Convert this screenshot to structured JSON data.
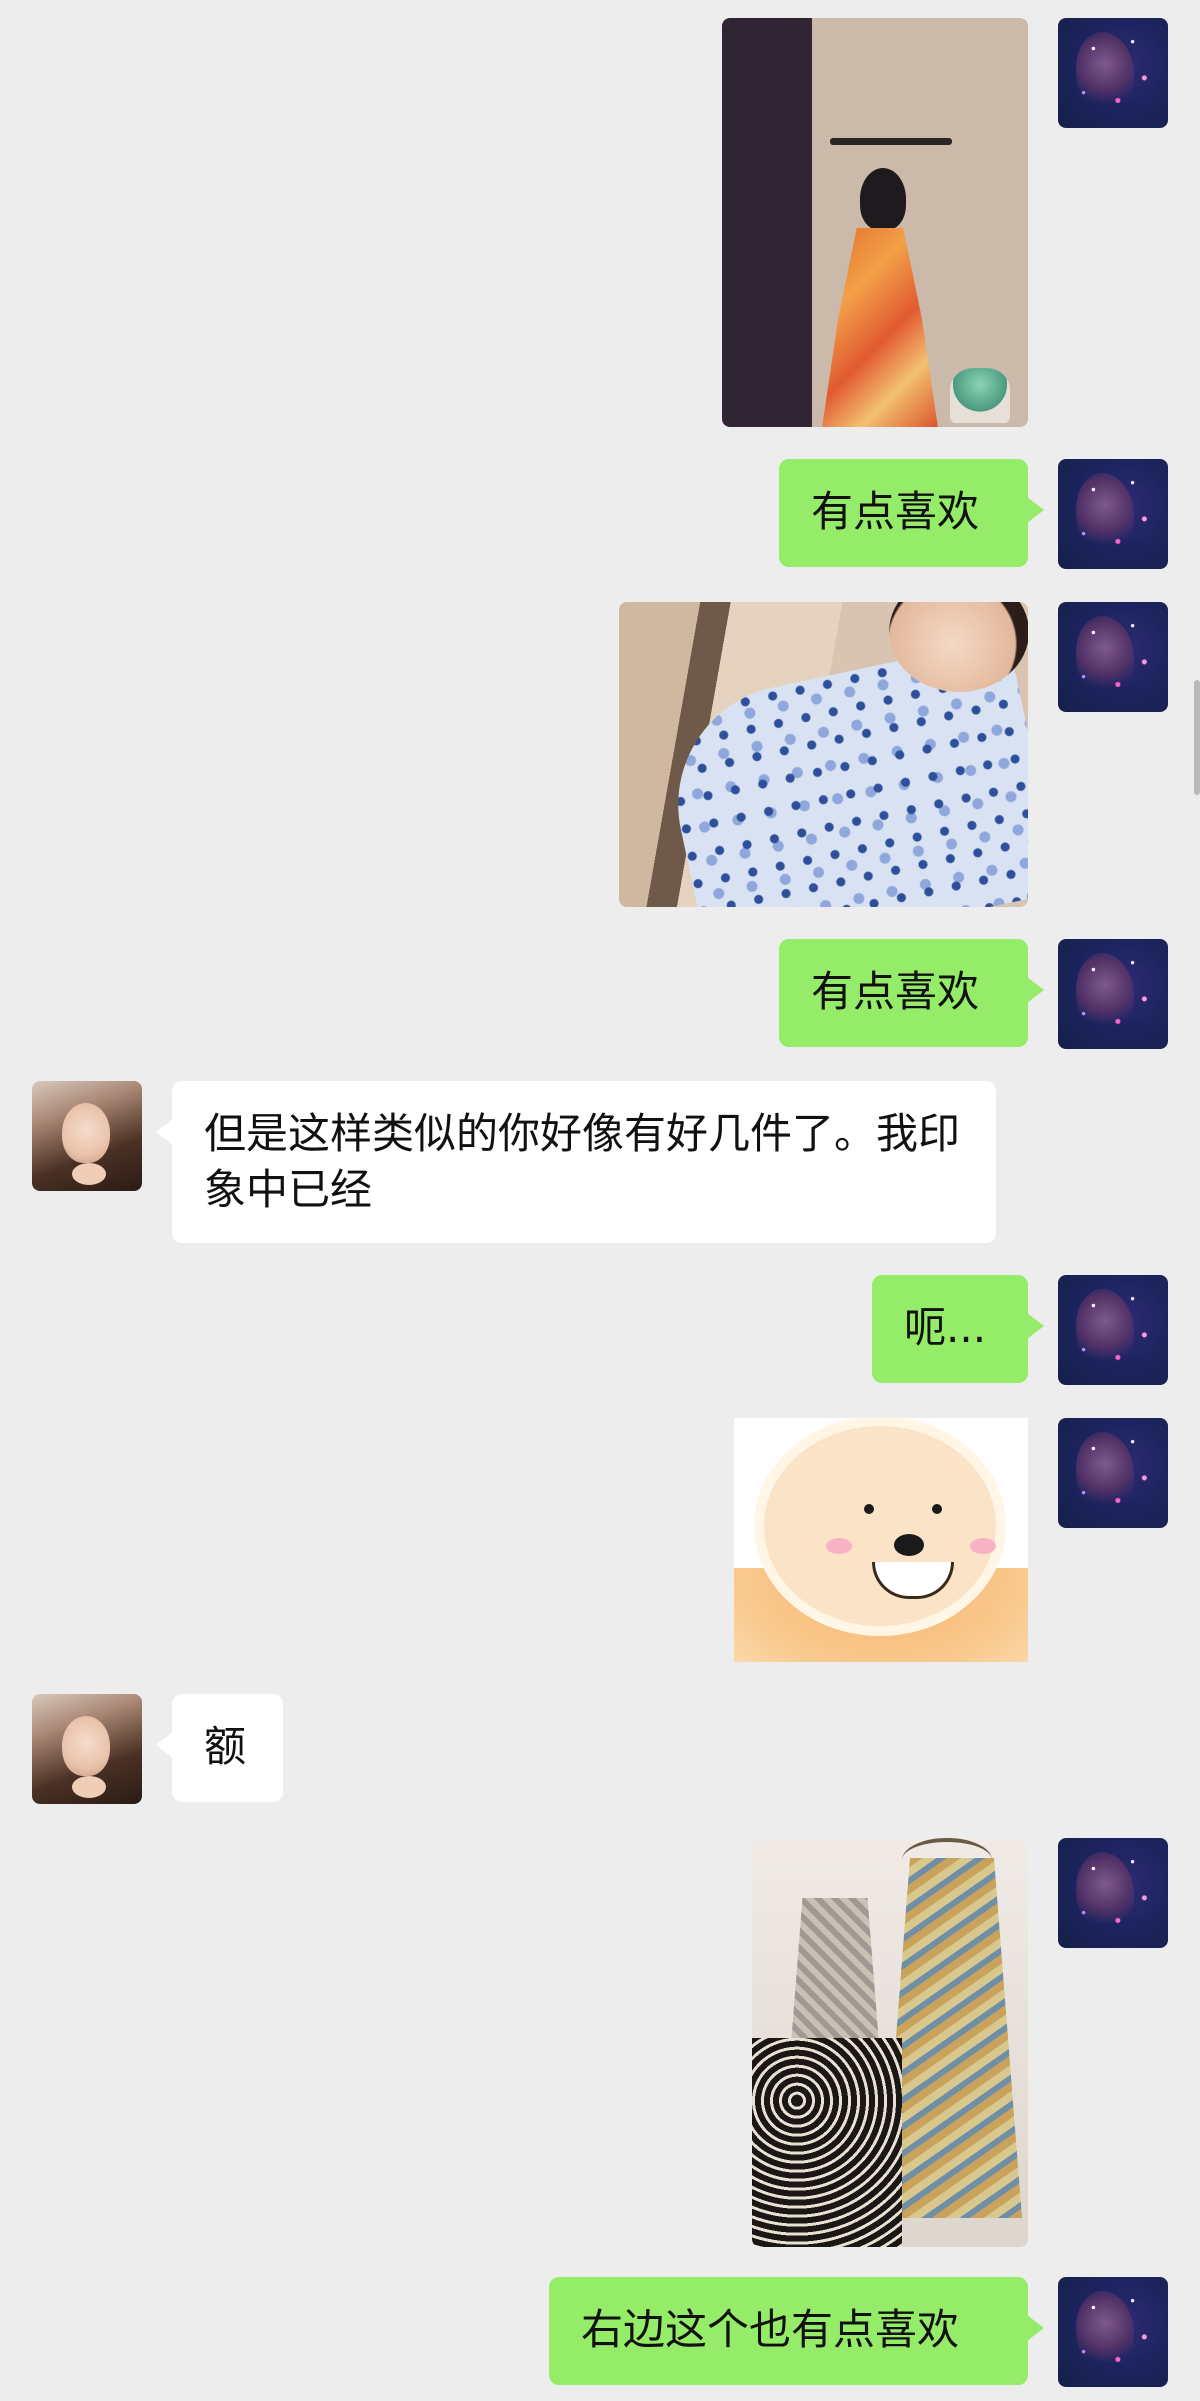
{
  "messages": [
    {
      "sender": "me",
      "kind": "photo",
      "desc": "dress-orange"
    },
    {
      "sender": "me",
      "kind": "text",
      "text": "有点喜欢"
    },
    {
      "sender": "me",
      "kind": "photo",
      "desc": "dress-blue"
    },
    {
      "sender": "me",
      "kind": "text",
      "text": "有点喜欢"
    },
    {
      "sender": "friend",
      "kind": "text",
      "text": "但是这样类似的你好像有好几件了。我印象中已经"
    },
    {
      "sender": "me",
      "kind": "text",
      "text": "呃..."
    },
    {
      "sender": "me",
      "kind": "sticker",
      "desc": "lamb-sticker"
    },
    {
      "sender": "friend",
      "kind": "text",
      "text": "额"
    },
    {
      "sender": "me",
      "kind": "photo",
      "desc": "dresses-rack"
    },
    {
      "sender": "me",
      "kind": "text",
      "text": "右边这个也有点喜欢"
    }
  ],
  "colors": {
    "background": "#ededed",
    "outgoing_bubble": "#95ec69",
    "incoming_bubble": "#ffffff"
  }
}
